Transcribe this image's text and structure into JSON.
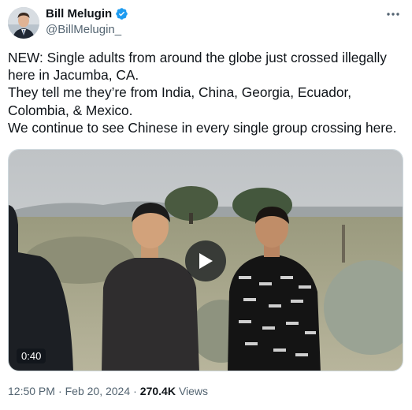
{
  "author": {
    "name": "Bill Melugin",
    "handle": "@BillMelugin_"
  },
  "tweet": {
    "lines": [
      "NEW: Single adults from around the globe just crossed illegally",
      "here in Jacumba, CA.",
      "They tell me they’re from India, China, Georgia, Ecuador,",
      "Colombia, & Mexico.",
      "We continue to see Chinese in every single group crossing here."
    ]
  },
  "video": {
    "duration": "0:40"
  },
  "footer": {
    "time": "12:50 PM",
    "separator": "·",
    "date": "Feb 20, 2024",
    "views_count": "270.4K",
    "views_label": "Views"
  },
  "colors": {
    "verified": "#1d9bf0",
    "secondary_text": "#536471",
    "primary_text": "#0f1419"
  }
}
